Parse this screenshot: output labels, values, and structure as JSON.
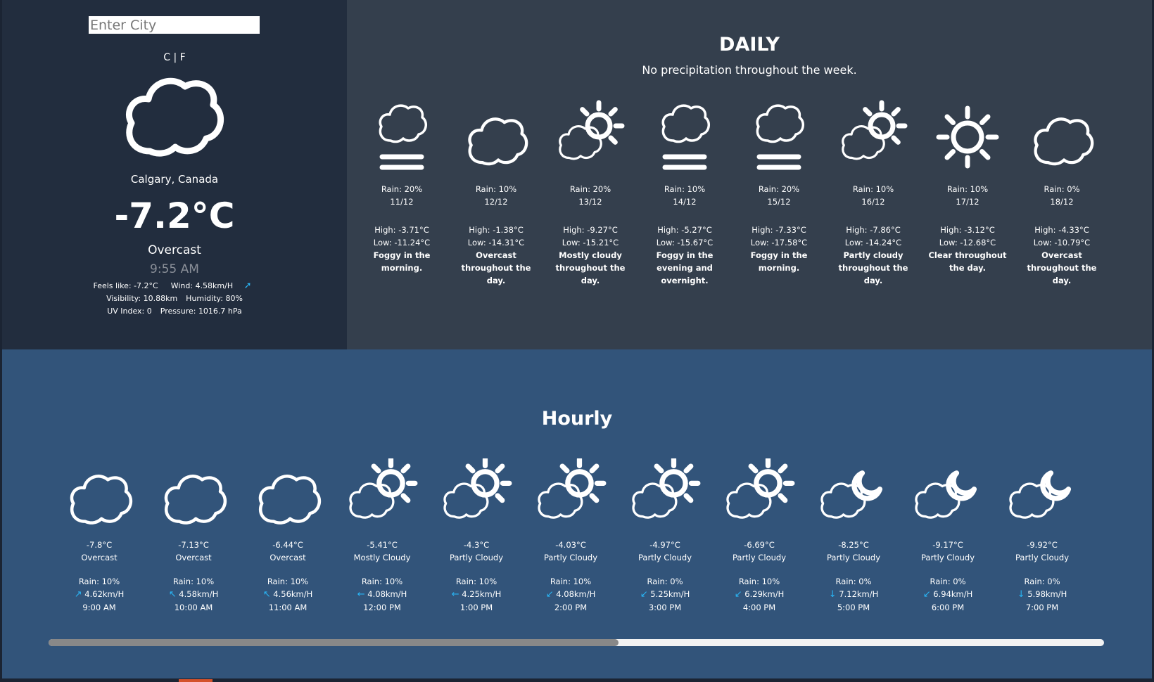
{
  "search": {
    "placeholder": "Enter City"
  },
  "units": {
    "celsius": "C",
    "separator": " | ",
    "fahrenheit": "F"
  },
  "current": {
    "icon": "cloud-icon",
    "location": "Calgary, Canada",
    "temperature": "-7.2°C",
    "condition": "Overcast",
    "time": "9:55 AM",
    "feels_like": "Feels like: -7.2°C",
    "wind": "Wind: 4.58km/H",
    "visibility": "Visibility: 10.88km",
    "humidity": "Humidity: 80%",
    "uv_index": "UV Index: 0",
    "pressure": "Pressure: 1016.7 hPa"
  },
  "daily": {
    "title": "DAILY",
    "summary": "No precipitation throughout the week.",
    "days": [
      {
        "icon": "fog",
        "rain": "Rain: 20%",
        "date": "11/12",
        "high": "High: -3.71°C",
        "low": "Low: -11.24°C",
        "summary": "Foggy in the morning."
      },
      {
        "icon": "cloudy",
        "rain": "Rain: 10%",
        "date": "12/12",
        "high": "High: -1.38°C",
        "low": "Low: -14.31°C",
        "summary": "Overcast throughout the day."
      },
      {
        "icon": "partly-cloudy-day",
        "rain": "Rain: 20%",
        "date": "13/12",
        "high": "High: -9.27°C",
        "low": "Low: -15.21°C",
        "summary": "Mostly cloudy throughout the day."
      },
      {
        "icon": "fog",
        "rain": "Rain: 10%",
        "date": "14/12",
        "high": "High: -5.27°C",
        "low": "Low: -15.67°C",
        "summary": "Foggy in the evening and overnight."
      },
      {
        "icon": "fog",
        "rain": "Rain: 20%",
        "date": "15/12",
        "high": "High: -7.33°C",
        "low": "Low: -17.58°C",
        "summary": "Foggy in the morning."
      },
      {
        "icon": "partly-cloudy-day",
        "rain": "Rain: 10%",
        "date": "16/12",
        "high": "High: -7.86°C",
        "low": "Low: -14.24°C",
        "summary": "Partly cloudy throughout the day."
      },
      {
        "icon": "clear-day",
        "rain": "Rain: 10%",
        "date": "17/12",
        "high": "High: -3.12°C",
        "low": "Low: -12.68°C",
        "summary": "Clear throughout the day."
      },
      {
        "icon": "cloudy",
        "rain": "Rain: 0%",
        "date": "18/12",
        "high": "High: -4.33°C",
        "low": "Low: -10.79°C",
        "summary": "Overcast throughout the day."
      }
    ]
  },
  "hourly": {
    "title": "Hourly",
    "scroll_position": 0.54,
    "hours": [
      {
        "icon": "cloudy",
        "temp": "-7.8°C",
        "condition": "Overcast",
        "rain": "Rain: 10%",
        "wind_arrow": "↗",
        "wind": "4.62km/H",
        "time": "9:00 AM"
      },
      {
        "icon": "cloudy",
        "temp": "-7.13°C",
        "condition": "Overcast",
        "rain": "Rain: 10%",
        "wind_arrow": "↖",
        "wind": "4.58km/H",
        "time": "10:00 AM"
      },
      {
        "icon": "cloudy",
        "temp": "-6.44°C",
        "condition": "Overcast",
        "rain": "Rain: 10%",
        "wind_arrow": "↖",
        "wind": "4.56km/H",
        "time": "11:00 AM"
      },
      {
        "icon": "partly-cloudy-day",
        "temp": "-5.41°C",
        "condition": "Mostly Cloudy",
        "rain": "Rain: 10%",
        "wind_arrow": "←",
        "wind": "4.08km/H",
        "time": "12:00 PM"
      },
      {
        "icon": "partly-cloudy-day",
        "temp": "-4.3°C",
        "condition": "Partly Cloudy",
        "rain": "Rain: 10%",
        "wind_arrow": "←",
        "wind": "4.25km/H",
        "time": "1:00 PM"
      },
      {
        "icon": "partly-cloudy-day",
        "temp": "-4.03°C",
        "condition": "Partly Cloudy",
        "rain": "Rain: 10%",
        "wind_arrow": "↙",
        "wind": "4.08km/H",
        "time": "2:00 PM"
      },
      {
        "icon": "partly-cloudy-day",
        "temp": "-4.97°C",
        "condition": "Partly Cloudy",
        "rain": "Rain: 0%",
        "wind_arrow": "↙",
        "wind": "5.25km/H",
        "time": "3:00 PM"
      },
      {
        "icon": "partly-cloudy-day",
        "temp": "-6.69°C",
        "condition": "Partly Cloudy",
        "rain": "Rain: 10%",
        "wind_arrow": "↙",
        "wind": "6.29km/H",
        "time": "4:00 PM"
      },
      {
        "icon": "partly-cloudy-night",
        "temp": "-8.25°C",
        "condition": "Partly Cloudy",
        "rain": "Rain: 0%",
        "wind_arrow": "↓",
        "wind": "7.12km/H",
        "time": "5:00 PM"
      },
      {
        "icon": "partly-cloudy-night",
        "temp": "-9.17°C",
        "condition": "Partly Cloudy",
        "rain": "Rain: 0%",
        "wind_arrow": "↙",
        "wind": "6.94km/H",
        "time": "6:00 PM"
      },
      {
        "icon": "partly-cloudy-night",
        "temp": "-9.92°C",
        "condition": "Partly Cloudy",
        "rain": "Rain: 0%",
        "wind_arrow": "↓",
        "wind": "5.98km/H",
        "time": "7:00 PM"
      }
    ]
  },
  "colors": {
    "left_panel": "#222d3e",
    "daily_panel": "#343f4d",
    "hourly_panel": "#32547a",
    "wind_arrow": "#29b6f6"
  }
}
